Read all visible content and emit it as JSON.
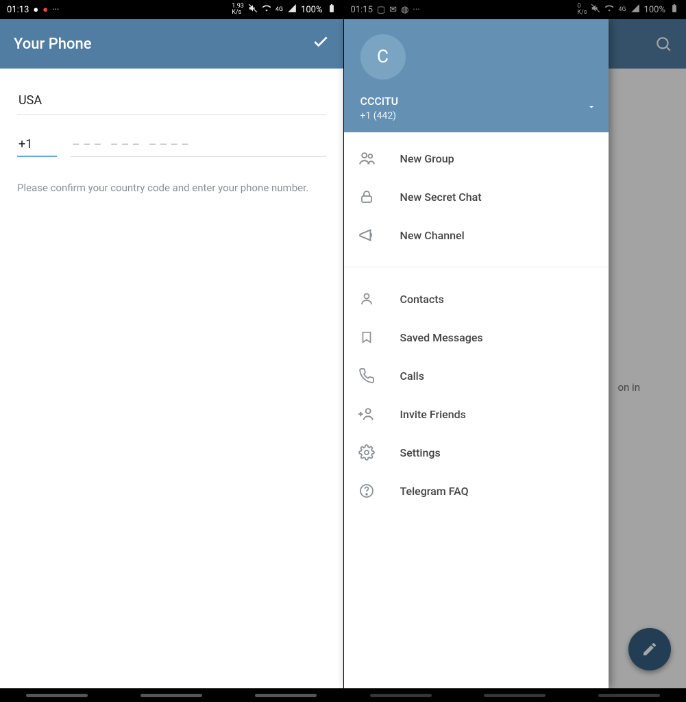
{
  "phone1": {
    "statusbar": {
      "time": "01:13",
      "speed": "1.93\nK/s",
      "net": "4G",
      "battery": "100%"
    },
    "appbar": {
      "title": "Your Phone"
    },
    "country": "USA",
    "code": "+1",
    "placeholder": "––– ––– ––––",
    "hint": "Please confirm your country code and enter your phone number."
  },
  "phone2": {
    "statusbar": {
      "time": "01:15",
      "speed": "0\nK/s",
      "net": "4G",
      "battery": "100%"
    },
    "drawer": {
      "avatar_initial": "C",
      "name": "CCCiTU",
      "phone": "+1 (442)"
    },
    "menu_group1": [
      {
        "icon": "group",
        "label": "New Group"
      },
      {
        "icon": "lock",
        "label": "New Secret Chat"
      },
      {
        "icon": "channel",
        "label": "New Channel"
      }
    ],
    "menu_group2": [
      {
        "icon": "contact",
        "label": "Contacts"
      },
      {
        "icon": "saved",
        "label": "Saved Messages"
      },
      {
        "icon": "call",
        "label": "Calls"
      },
      {
        "icon": "invite",
        "label": "Invite Friends"
      },
      {
        "icon": "settings",
        "label": "Settings"
      },
      {
        "icon": "help",
        "label": "Telegram FAQ"
      }
    ],
    "bg_hint": "on in"
  }
}
